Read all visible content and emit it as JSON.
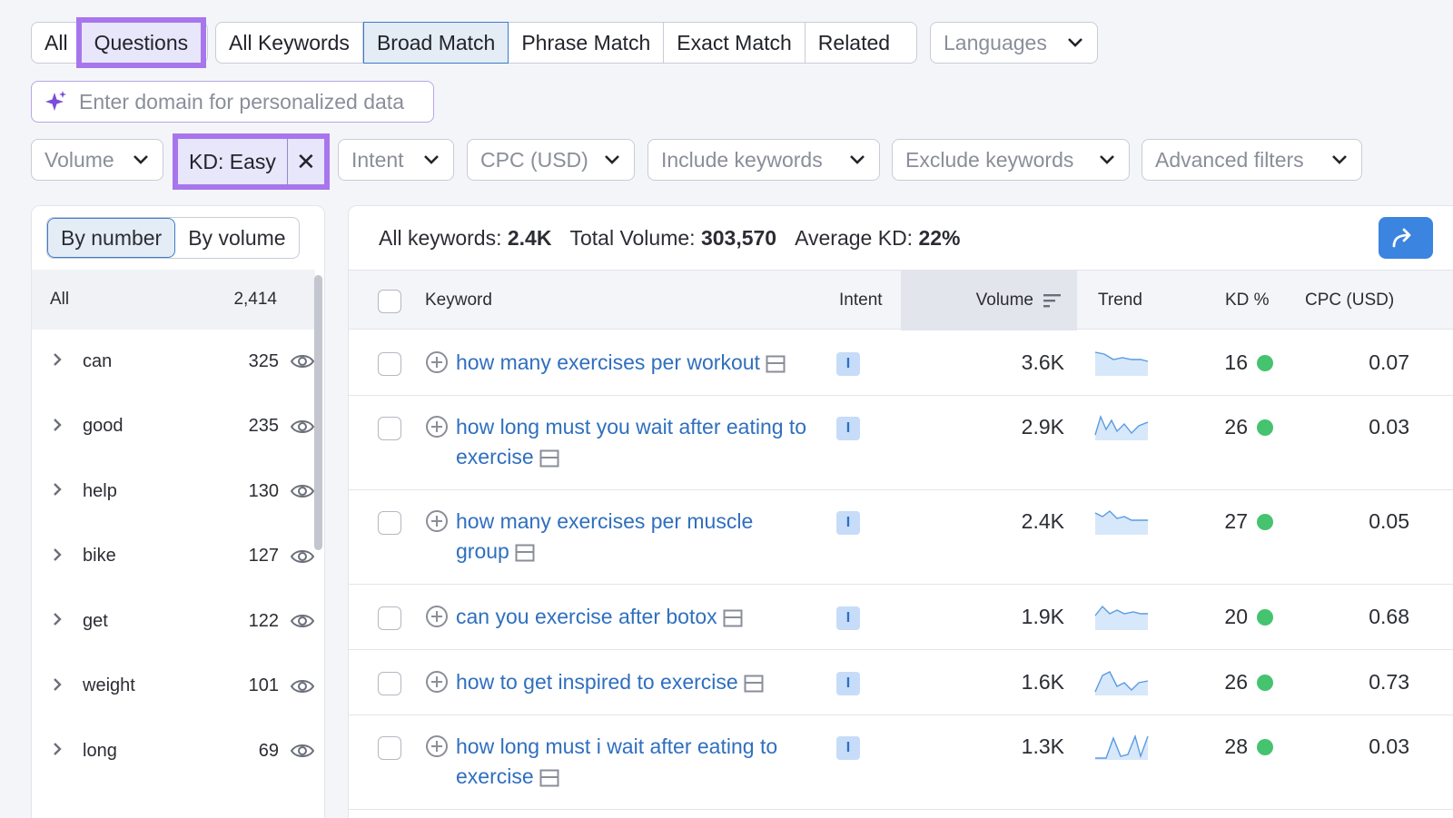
{
  "tabs_group1": [
    "All",
    "Questions"
  ],
  "tabs_group2": [
    "All Keywords",
    "Broad Match",
    "Phrase Match",
    "Exact Match",
    "Related"
  ],
  "languages_label": "Languages",
  "domain_placeholder": "Enter domain for personalized data",
  "filters": {
    "volume": "Volume",
    "kd_chip": "KD: Easy",
    "kd_close": "✕",
    "intent": "Intent",
    "cpc": "CPC (USD)",
    "include": "Include keywords",
    "exclude": "Exclude keywords",
    "advanced": "Advanced filters"
  },
  "left": {
    "toggle": [
      "By number",
      "By volume"
    ],
    "all_label": "All",
    "all_count": "2,414",
    "groups": [
      {
        "word": "can",
        "count": "325"
      },
      {
        "word": "good",
        "count": "235"
      },
      {
        "word": "help",
        "count": "130"
      },
      {
        "word": "bike",
        "count": "127"
      },
      {
        "word": "get",
        "count": "122"
      },
      {
        "word": "weight",
        "count": "101"
      },
      {
        "word": "long",
        "count": "69"
      }
    ]
  },
  "summary": {
    "all_label": "All keywords:",
    "all_value": "2.4K",
    "total_label": "Total Volume:",
    "total_value": "303,570",
    "avg_label": "Average KD:",
    "avg_value": "22%"
  },
  "headers": {
    "keyword": "Keyword",
    "intent": "Intent",
    "volume": "Volume",
    "trend": "Trend",
    "kd": "KD %",
    "cpc": "CPC (USD)"
  },
  "rows": [
    {
      "keyword": "how many exercises per workout",
      "intent": "I",
      "volume": "3.6K",
      "kd": "16",
      "cpc": "0.07"
    },
    {
      "keyword": "how long must you wait after eating to exercise",
      "intent": "I",
      "volume": "2.9K",
      "kd": "26",
      "cpc": "0.03"
    },
    {
      "keyword": "how many exercises per muscle group",
      "intent": "I",
      "volume": "2.4K",
      "kd": "27",
      "cpc": "0.05"
    },
    {
      "keyword": "can you exercise after botox",
      "intent": "I",
      "volume": "1.9K",
      "kd": "20",
      "cpc": "0.68"
    },
    {
      "keyword": "how to get inspired to exercise",
      "intent": "I",
      "volume": "1.6K",
      "kd": "26",
      "cpc": "0.73"
    },
    {
      "keyword": "how long must i wait after eating to exercise",
      "intent": "I",
      "volume": "1.3K",
      "kd": "28",
      "cpc": "0.03"
    }
  ],
  "colors": {
    "accent": "#3c7cc8",
    "highlight": "#a876ec",
    "link": "#2f6fbf",
    "kd_easy": "#45c36f"
  }
}
